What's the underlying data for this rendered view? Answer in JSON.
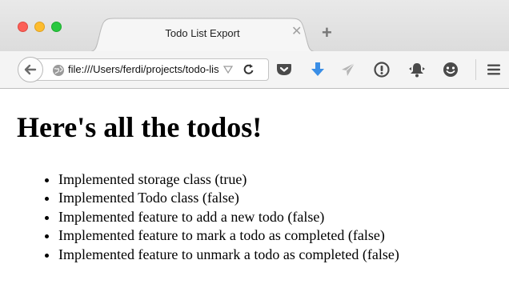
{
  "browser": {
    "tab": {
      "title": "Todo List Export",
      "close_glyph": "✕",
      "icon": "close-icon"
    },
    "new_tab": {
      "glyph": "+",
      "icon": "plus-icon"
    },
    "traffic_lights": {
      "close_color": "#fc5f57",
      "minimize_color": "#fdbc2e",
      "maximize_color": "#29c840"
    },
    "navbar": {
      "url": "file:///Users/ferdi/projects/todo-list/export.html",
      "icons": [
        "back-arrow-icon",
        "globe-icon",
        "dropdown-arrow-icon",
        "reload-icon",
        "pocket-icon",
        "download-icon",
        "send-icon",
        "info-circle-icon",
        "notification-bell-icon",
        "emoji-icon",
        "hamburger-menu-icon"
      ],
      "download_color": "#3a8ee6"
    }
  },
  "page": {
    "heading": "Here's all the todos!",
    "todos": [
      "Implemented storage class (true)",
      "Implemented Todo class (false)",
      "Implemented feature to add a new todo (false)",
      "Implemented feature to mark a todo as completed (false)",
      "Implemented feature to unmark a todo as completed (false)"
    ]
  }
}
